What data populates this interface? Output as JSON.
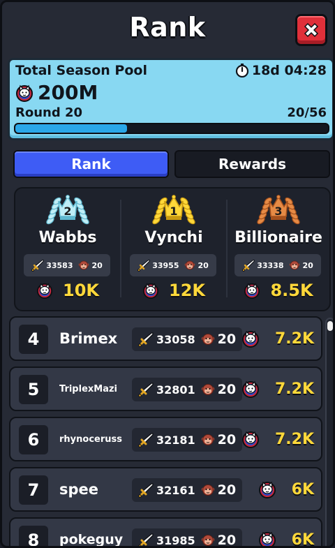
{
  "header": {
    "title": "Rank",
    "close_icon": "close-x-icon"
  },
  "pool": {
    "label": "Total Season Pool",
    "timer": "18d 04:28",
    "timer_icon": "stopwatch-icon",
    "amount": "200M",
    "amount_icon": "cat-coin-icon",
    "round": "Round 20",
    "progress_text": "20/56",
    "progress_fraction": 0.357
  },
  "tabs": [
    {
      "label": "Rank",
      "active": true
    },
    {
      "label": "Rewards",
      "active": false
    }
  ],
  "podium": [
    {
      "place": "2",
      "name": "Wabbs",
      "power": "33583",
      "level": "20",
      "reward": "10K",
      "laurel_color": "#bfeef7",
      "laurel_dark": "#5fb8cf"
    },
    {
      "place": "1",
      "name": "Vynchi",
      "power": "33955",
      "level": "20",
      "reward": "12K",
      "laurel_color": "#ffd83a",
      "laurel_dark": "#c99a10"
    },
    {
      "place": "3",
      "name": "Billionaire",
      "power": "33338",
      "level": "20",
      "reward": "8.5K",
      "laurel_color": "#e58a45",
      "laurel_dark": "#a4501c"
    }
  ],
  "rows": [
    {
      "rank": "4",
      "name": "Brimex",
      "power": "33058",
      "level": "20",
      "reward": "7.2K",
      "name_size": "21px"
    },
    {
      "rank": "5",
      "name": "TriplexMazi",
      "power": "32801",
      "level": "20",
      "reward": "7.2K",
      "name_size": "13px"
    },
    {
      "rank": "6",
      "name": "rhynoceruss",
      "power": "32181",
      "level": "20",
      "reward": "7.2K",
      "name_size": "13px"
    },
    {
      "rank": "7",
      "name": "spee",
      "power": "32161",
      "level": "20",
      "reward": "6K",
      "name_size": "21px"
    },
    {
      "rank": "8",
      "name": "pokeguy",
      "power": "31985",
      "level": "20",
      "reward": "6K",
      "name_size": "19px"
    }
  ],
  "icons": {
    "power": "sword-icon",
    "level": "monkey-face-icon",
    "reward": "cat-coin-icon"
  },
  "colors": {
    "accent_blue": "#3e5cf5",
    "gold_text": "#ffd83a",
    "pool_bg": "#88d8f2",
    "close_red": "#e0303a"
  }
}
